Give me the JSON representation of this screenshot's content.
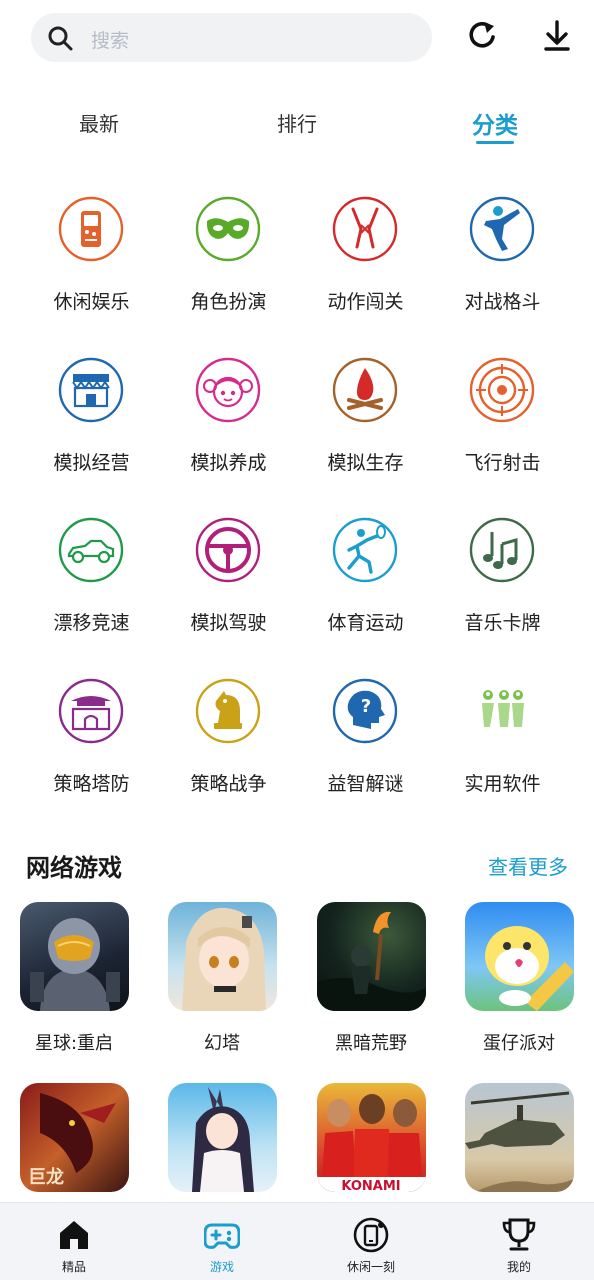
{
  "search": {
    "placeholder": "搜索"
  },
  "toolbar": {
    "refresh_icon": "refresh-icon",
    "download_icon": "download-icon"
  },
  "tabs": [
    {
      "label": "最新",
      "active": false
    },
    {
      "label": "排行",
      "active": false
    },
    {
      "label": "分类",
      "active": true
    }
  ],
  "accent_color": "#1b9dd0",
  "categories": [
    {
      "label": "休闲娱乐",
      "icon": "gameboy-icon",
      "color": "#e5602a"
    },
    {
      "label": "角色扮演",
      "icon": "mask-icon",
      "color": "#5aaa2a"
    },
    {
      "label": "动作闯关",
      "icon": "swords-icon",
      "color": "#d42a2a"
    },
    {
      "label": "对战格斗",
      "icon": "fighter-icon",
      "color": "#1f68b0"
    },
    {
      "label": "模拟经营",
      "icon": "shop-icon",
      "color": "#1f68b0"
    },
    {
      "label": "模拟养成",
      "icon": "girl-face-icon",
      "color": "#d62a8c"
    },
    {
      "label": "模拟生存",
      "icon": "campfire-icon",
      "color": "#a4622a"
    },
    {
      "label": "飞行射击",
      "icon": "target-icon",
      "color": "#e5602a"
    },
    {
      "label": "漂移竞速",
      "icon": "race-car-icon",
      "color": "#1f9a4a"
    },
    {
      "label": "模拟驾驶",
      "icon": "steering-wheel-icon",
      "color": "#b0207a"
    },
    {
      "label": "体育运动",
      "icon": "tennis-player-icon",
      "color": "#1b9dd0"
    },
    {
      "label": "音乐卡牌",
      "icon": "music-note-icon",
      "color": "#3e6a4a"
    },
    {
      "label": "策略塔防",
      "icon": "castle-icon",
      "color": "#8a2a8a"
    },
    {
      "label": "策略战争",
      "icon": "chess-knight-icon",
      "color": "#c9a218"
    },
    {
      "label": "益智解谜",
      "icon": "brain-question-icon",
      "color": "#1f68b0"
    },
    {
      "label": "实用软件",
      "icon": "frog-tools-icon",
      "color": "#7ac24a"
    }
  ],
  "online_games": {
    "title": "网络游戏",
    "more": "查看更多",
    "games": [
      {
        "name": "星球:重启"
      },
      {
        "name": "幻塔"
      },
      {
        "name": "黑暗荒野"
      },
      {
        "name": "蛋仔派对"
      },
      {
        "name": ""
      },
      {
        "name": ""
      },
      {
        "name": ""
      },
      {
        "name": ""
      }
    ],
    "thumb_text": {
      "dragon": "巨龙",
      "konami": "KONAMI"
    }
  },
  "bottom_nav": [
    {
      "label": "精品",
      "icon": "home-icon",
      "active": false
    },
    {
      "label": "游戏",
      "icon": "gamepad-icon",
      "active": true
    },
    {
      "label": "休闲一刻",
      "icon": "phone-icon",
      "active": false
    },
    {
      "label": "我的",
      "icon": "trophy-icon",
      "active": false
    }
  ]
}
